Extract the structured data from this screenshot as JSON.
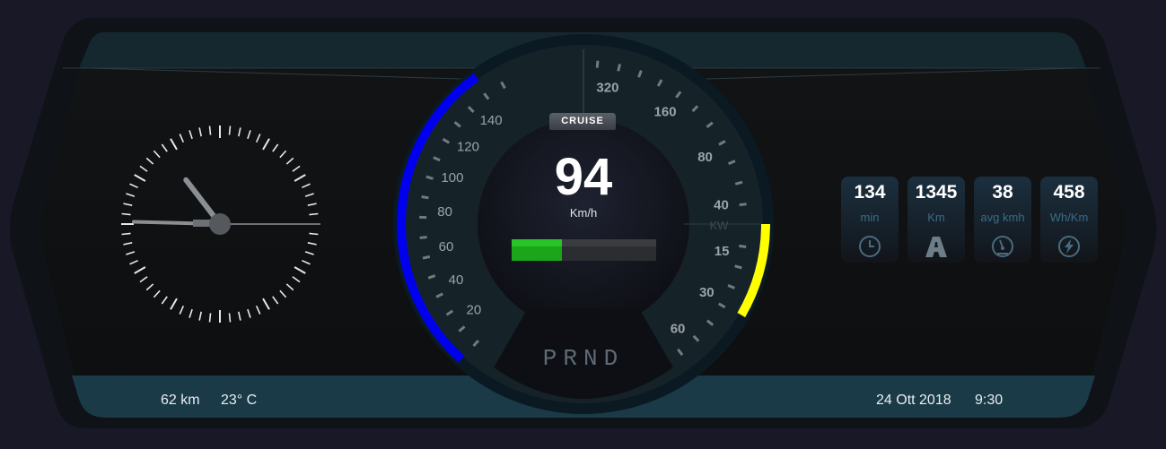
{
  "speedometer": {
    "speed": "94",
    "speed_unit": "Km/h",
    "cruise_label": "CRUISE",
    "gear_selector": "PRND",
    "speed_ticks": [
      "20",
      "40",
      "60",
      "80",
      "100",
      "120",
      "140"
    ],
    "battery_level_fraction": 0.35,
    "speed_arc_color": "#0000ee",
    "battery_color": "#1aa51a"
  },
  "power_meter": {
    "label": "KW",
    "upper_ticks": [
      "320",
      "160",
      "80",
      "40"
    ],
    "lower_ticks": [
      "15",
      "30",
      "60"
    ],
    "regen_arc_color": "#ffff00"
  },
  "clock": {
    "hour": 10,
    "minute": 45,
    "second": 15
  },
  "stats": [
    {
      "value": "134",
      "unit": "min",
      "icon": "clock-icon"
    },
    {
      "value": "1345",
      "unit": "Km",
      "icon": "road-icon"
    },
    {
      "value": "38",
      "unit": "avg kmh",
      "icon": "gauge-icon"
    },
    {
      "value": "458",
      "unit": "Wh/Km",
      "icon": "lightning-icon"
    }
  ],
  "footer": {
    "range": "62 km",
    "temperature": "23° C",
    "date": "24 Ott 2018",
    "time": "9:30"
  }
}
